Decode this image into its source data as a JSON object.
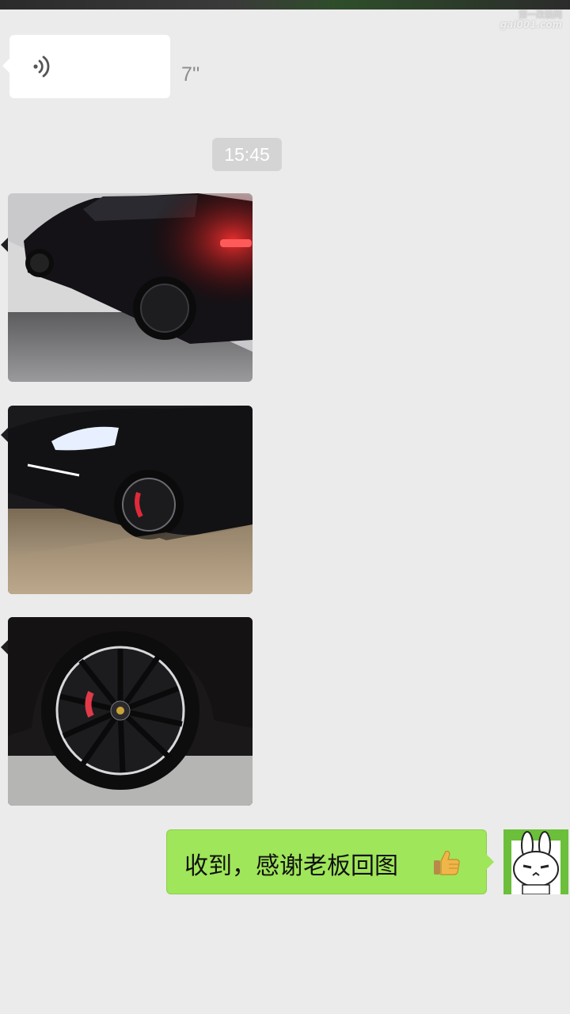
{
  "watermark": {
    "line1": "第一改装网",
    "line2": "gai001.com"
  },
  "voice_message": {
    "duration": "7''"
  },
  "time_divider": "15:45",
  "photos": [
    {
      "name": "photo-car-rear"
    },
    {
      "name": "photo-car-front"
    },
    {
      "name": "photo-wheel"
    }
  ],
  "sent_message": {
    "text": "收到，感谢老板回图",
    "emoji": "thumbs-up-icon"
  },
  "colors": {
    "background": "#ebebeb",
    "sent_bubble": "#9fe65a",
    "received_bubble": "#ffffff",
    "time_badge": "#d4d4d4"
  }
}
